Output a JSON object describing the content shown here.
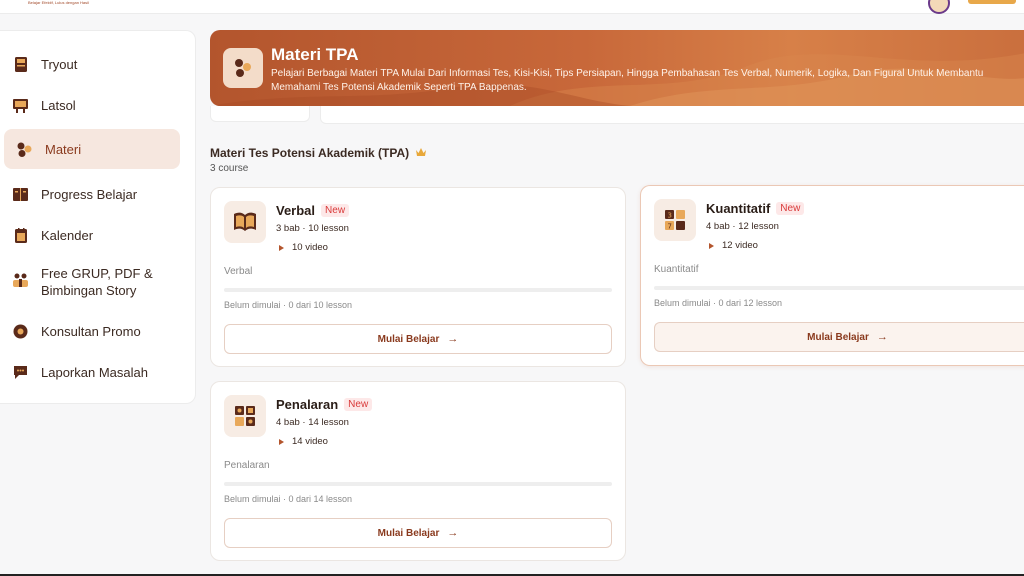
{
  "header": {
    "logo_subtext": "Belajar Efektif, Lulus dengan Hasil"
  },
  "sidebar": {
    "items": [
      {
        "label": "Tryout",
        "icon": "book-icon"
      },
      {
        "label": "Latsol",
        "icon": "chalkboard-icon"
      },
      {
        "label": "Materi",
        "icon": "molecule-icon",
        "active": true
      },
      {
        "label": "Progress Belajar",
        "icon": "progress-book-icon"
      },
      {
        "label": "Kalender",
        "icon": "calendar-icon"
      },
      {
        "label": "Free GRUP, PDF & Bimbingan Story",
        "icon": "group-icon"
      },
      {
        "label": "Konsultan Promo",
        "icon": "gear-icon"
      },
      {
        "label": "Laporkan Masalah",
        "icon": "chat-icon"
      }
    ]
  },
  "banner": {
    "title": "Materi TPA",
    "description": "Pelajari Berbagai Materi TPA Mulai Dari Informasi Tes, Kisi-Kisi, Tips Persiapan, Hingga Pembahasan Tes Verbal, Numerik, Logika, Dan Figural Untuk Membantu Memahami Tes Potensi Akademik Seperti TPA Bappenas."
  },
  "section": {
    "title": "Materi Tes Potensi Akademik (TPA)",
    "count": "3 course"
  },
  "courses": [
    {
      "title": "Verbal",
      "badge": "New",
      "meta": "3 bab · 10 lesson",
      "video": "10 video",
      "desc": "Verbal",
      "status": "Belum dimulai · 0 dari 10 lesson",
      "progress": 0,
      "button": "Mulai Belajar",
      "icon": "open-book-icon"
    },
    {
      "title": "Kuantitatif",
      "badge": "New",
      "meta": "4 bab · 12 lesson",
      "video": "12 video",
      "desc": "Kuantitatif",
      "status": "Belum dimulai · 0 dari 12 lesson",
      "progress": 0,
      "button": "Mulai Belajar",
      "icon": "number-blocks-icon"
    },
    {
      "title": "Penalaran",
      "badge": "New",
      "meta": "4 bab · 14 lesson",
      "video": "14 video",
      "desc": "Penalaran",
      "status": "Belum dimulai · 0 dari 14 lesson",
      "progress": 0,
      "button": "Mulai Belajar",
      "icon": "puzzle-blocks-icon"
    }
  ],
  "colors": {
    "accent": "#b3552d",
    "badge_text": "#d93a3a",
    "active_bg": "#f6e7df"
  }
}
